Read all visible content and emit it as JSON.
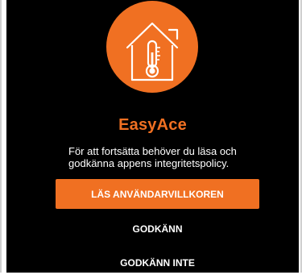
{
  "app": {
    "name": "EasyAce",
    "logo_icon": "house-thermometer-icon",
    "accent_color": "#f07022"
  },
  "consent": {
    "message_line1": "För att fortsätta behöver du läsa och",
    "message_line2": "godkänna appens integritetspolicy.",
    "read_terms_label": "LÄS ANVÄNDARVILLKOREN",
    "accept_label": "GODKÄNN",
    "decline_label": "GODKÄNN INTE"
  }
}
